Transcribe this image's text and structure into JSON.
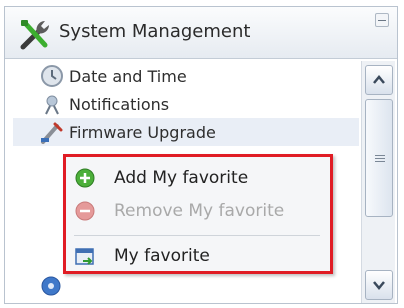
{
  "panel": {
    "title": "System Management",
    "header_icon": "tools-icon",
    "collapse_icon": "minimize-icon"
  },
  "tree": {
    "items": [
      {
        "label": "Date and Time",
        "icon": "clock-icon"
      },
      {
        "label": "Notifications",
        "icon": "bell-icon"
      },
      {
        "label": "Firmware Upgrade",
        "icon": "firmware-icon"
      }
    ]
  },
  "context_menu": {
    "items": [
      {
        "label": "Add My favorite",
        "icon": "plus-circle-icon",
        "enabled": true
      },
      {
        "label": "Remove My favorite",
        "icon": "minus-circle-icon",
        "enabled": false
      },
      {
        "label": "My favorite",
        "icon": "favorite-icon",
        "enabled": true
      }
    ],
    "highlight_color": "#e01c24"
  },
  "scrollbar": {
    "up_icon": "arrow-up-icon",
    "down_icon": "arrow-down-icon",
    "grip_icon": "grip-icon"
  }
}
